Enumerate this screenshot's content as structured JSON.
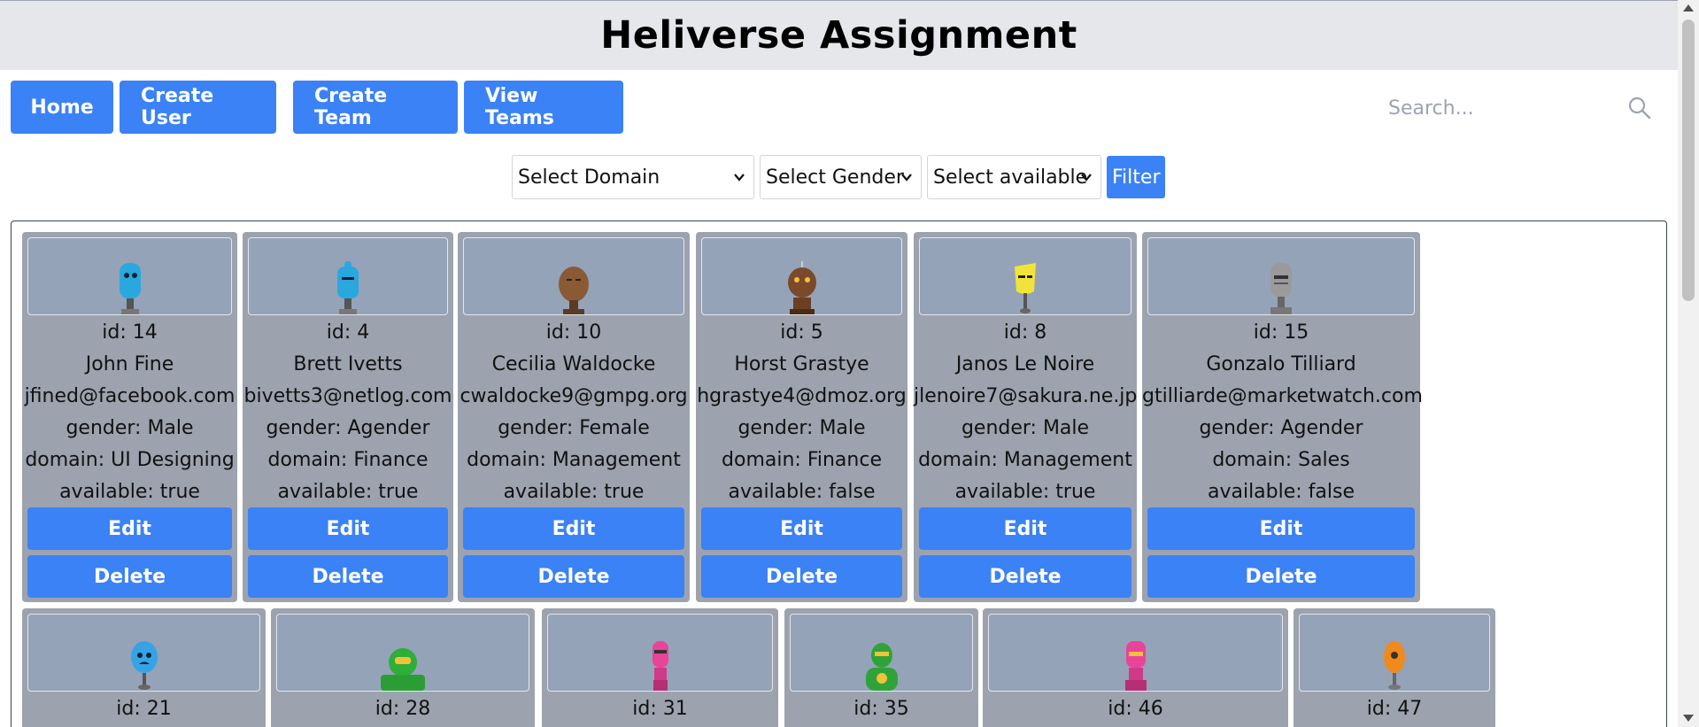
{
  "header": {
    "title": "Heliverse Assignment"
  },
  "nav": {
    "home": "Home",
    "create_user": "Create User",
    "create_team": "Create Team",
    "view_teams": "View Teams"
  },
  "search": {
    "placeholder": "Search..."
  },
  "filters": {
    "domain": "Select Domain",
    "gender": "Select Gender",
    "available": "Select available",
    "button": "Filter"
  },
  "colors": {
    "primary": "#3b82f6",
    "card_bg": "#9ca3af",
    "avatar_bg": "#94a3b8",
    "header_bg": "#e5e7eb"
  },
  "users": [
    {
      "id": "id: 14",
      "name": "John Fine",
      "email": "jfined@facebook.com",
      "gender": "gender: Male",
      "domain": "domain: UI Designing",
      "available": "available: true",
      "avatar_color": "#29a8e0",
      "avatar_icon": "robot-avatar-icon"
    },
    {
      "id": "id: 4",
      "name": "Brett Ivetts",
      "email": "bivetts3@netlog.com",
      "gender": "gender: Agender",
      "domain": "domain: Finance",
      "available": "available: true",
      "avatar_color": "#2aa7df",
      "avatar_icon": "robot-avatar-icon"
    },
    {
      "id": "id: 10",
      "name": "Cecilia Waldocke",
      "email": "cwaldocke9@gmpg.org",
      "gender": "gender: Female",
      "domain": "domain: Management",
      "available": "available: true",
      "avatar_color": "#8a5a35",
      "avatar_icon": "robot-avatar-icon"
    },
    {
      "id": "id: 5",
      "name": "Horst Grastye",
      "email": "hgrastye4@dmoz.org",
      "gender": "gender: Male",
      "domain": "domain: Finance",
      "available": "available: false",
      "avatar_color": "#7a4a2a",
      "avatar_icon": "robot-avatar-icon"
    },
    {
      "id": "id: 8",
      "name": "Janos Le Noire",
      "email": "jlenoire7@sakura.ne.jp",
      "gender": "gender: Male",
      "domain": "domain: Management",
      "available": "available: true",
      "avatar_color": "#f2e33a",
      "avatar_icon": "robot-avatar-icon"
    },
    {
      "id": "id: 15",
      "name": "Gonzalo Tilliard",
      "email": "gtilliarde@marketwatch.com",
      "gender": "gender: Agender",
      "domain": "domain: Sales",
      "available": "available: false",
      "avatar_color": "#9a9a9a",
      "avatar_icon": "robot-avatar-icon"
    }
  ],
  "users_row2": [
    {
      "id": "id: 21",
      "avatar_color": "#35a3e6",
      "avatar_icon": "robot-avatar-icon"
    },
    {
      "id": "id: 28",
      "avatar_color": "#2fae3a",
      "avatar_icon": "robot-avatar-icon"
    },
    {
      "id": "id: 31",
      "avatar_color": "#e8449a",
      "avatar_icon": "robot-avatar-icon"
    },
    {
      "id": "id: 35",
      "avatar_color": "#2fa33a",
      "avatar_icon": "robot-avatar-icon"
    },
    {
      "id": "id: 46",
      "avatar_color": "#e8449a",
      "avatar_icon": "robot-avatar-icon"
    },
    {
      "id": "id: 47",
      "avatar_color": "#f08a1c",
      "avatar_icon": "robot-avatar-icon"
    }
  ],
  "actions": {
    "edit": "Edit",
    "delete": "Delete"
  }
}
